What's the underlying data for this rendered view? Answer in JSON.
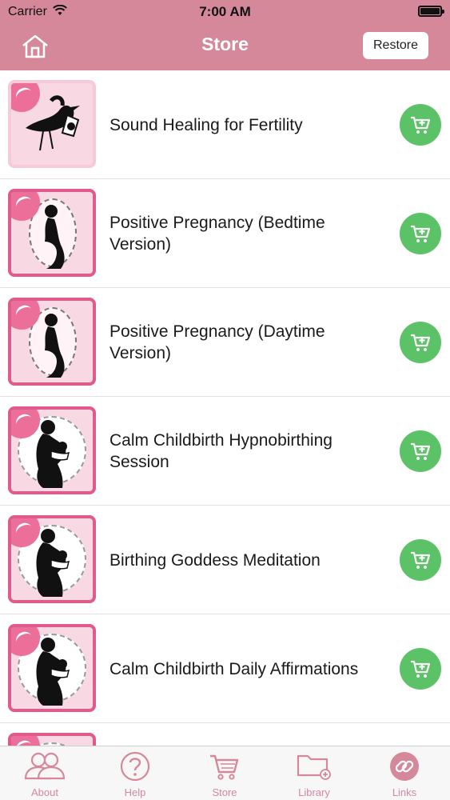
{
  "status_bar": {
    "carrier": "Carrier",
    "time": "7:00 AM"
  },
  "nav": {
    "title": "Store",
    "restore_label": "Restore"
  },
  "items": [
    {
      "title": "Sound Healing for Fertility"
    },
    {
      "title": "Positive Pregnancy (Bedtime Version)"
    },
    {
      "title": "Positive Pregnancy (Daytime Version)"
    },
    {
      "title": "Calm Childbirth Hypnobirthing Session"
    },
    {
      "title": "Birthing Goddess Meditation"
    },
    {
      "title": "Calm Childbirth Daily Affirmations"
    },
    {
      "title": ""
    }
  ],
  "tabs": [
    {
      "label": "About",
      "icon": "people-icon"
    },
    {
      "label": "Help",
      "icon": "question-icon"
    },
    {
      "label": "Store",
      "icon": "cart-icon"
    },
    {
      "label": "Library",
      "icon": "folder-add-icon"
    },
    {
      "label": "Links",
      "icon": "link-icon"
    }
  ],
  "colors": {
    "header": "#d4889a",
    "cart_button": "#5cc268",
    "thumb_border": "#e15a8c",
    "tab_tint": "#d4889a"
  }
}
